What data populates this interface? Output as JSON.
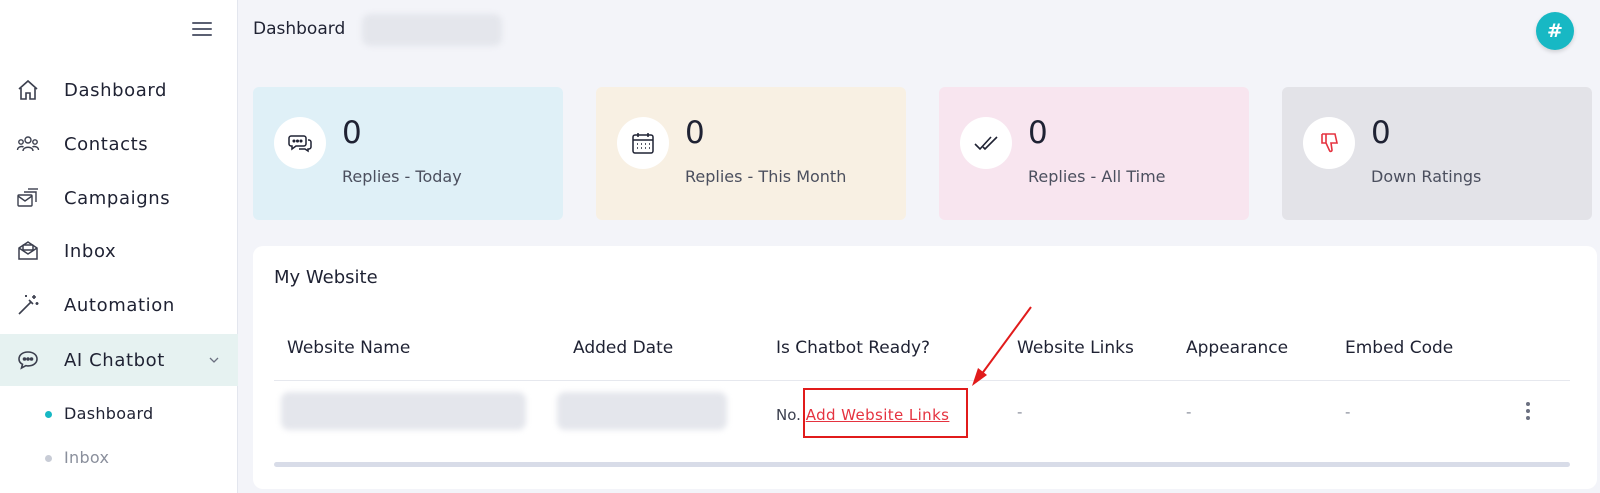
{
  "header": {
    "title": "Dashboard",
    "avatar_label": "#"
  },
  "sidebar": {
    "items": [
      {
        "label": "Dashboard",
        "icon": "home-icon"
      },
      {
        "label": "Contacts",
        "icon": "contacts-icon"
      },
      {
        "label": "Campaigns",
        "icon": "campaigns-icon"
      },
      {
        "label": "Inbox",
        "icon": "inbox-icon"
      },
      {
        "label": "Automation",
        "icon": "magic-wand-icon"
      },
      {
        "label": "AI Chatbot",
        "icon": "chatbot-icon",
        "active": true
      }
    ],
    "subitems": [
      {
        "label": "Dashboard",
        "active": true
      },
      {
        "label": "Inbox",
        "active": false
      }
    ]
  },
  "stats": [
    {
      "value": "0",
      "label": "Replies - Today",
      "color": "#dff0f7",
      "icon": "chat-bubbles-icon"
    },
    {
      "value": "0",
      "label": "Replies - This Month",
      "color": "#f8f0e3",
      "icon": "calendar-icon"
    },
    {
      "value": "0",
      "label": "Replies - All Time",
      "color": "#f8e5ef",
      "icon": "double-check-icon"
    },
    {
      "value": "0",
      "label": "Down Ratings",
      "color": "#e3e3e8",
      "icon": "thumbs-down-icon"
    }
  ],
  "website": {
    "title": "My Website",
    "columns": [
      "Website Name",
      "Added Date",
      "Is Chatbot Ready?",
      "Website Links",
      "Appearance",
      "Embed Code"
    ],
    "row": {
      "ready_prefix": "No.",
      "ready_link": "Add Website Links",
      "website_links": "-",
      "appearance": "-",
      "embed_code": "-"
    }
  },
  "colors": {
    "accent": "#17b8c4",
    "link_red": "#e53340",
    "annotation_red": "#e11b1b"
  }
}
